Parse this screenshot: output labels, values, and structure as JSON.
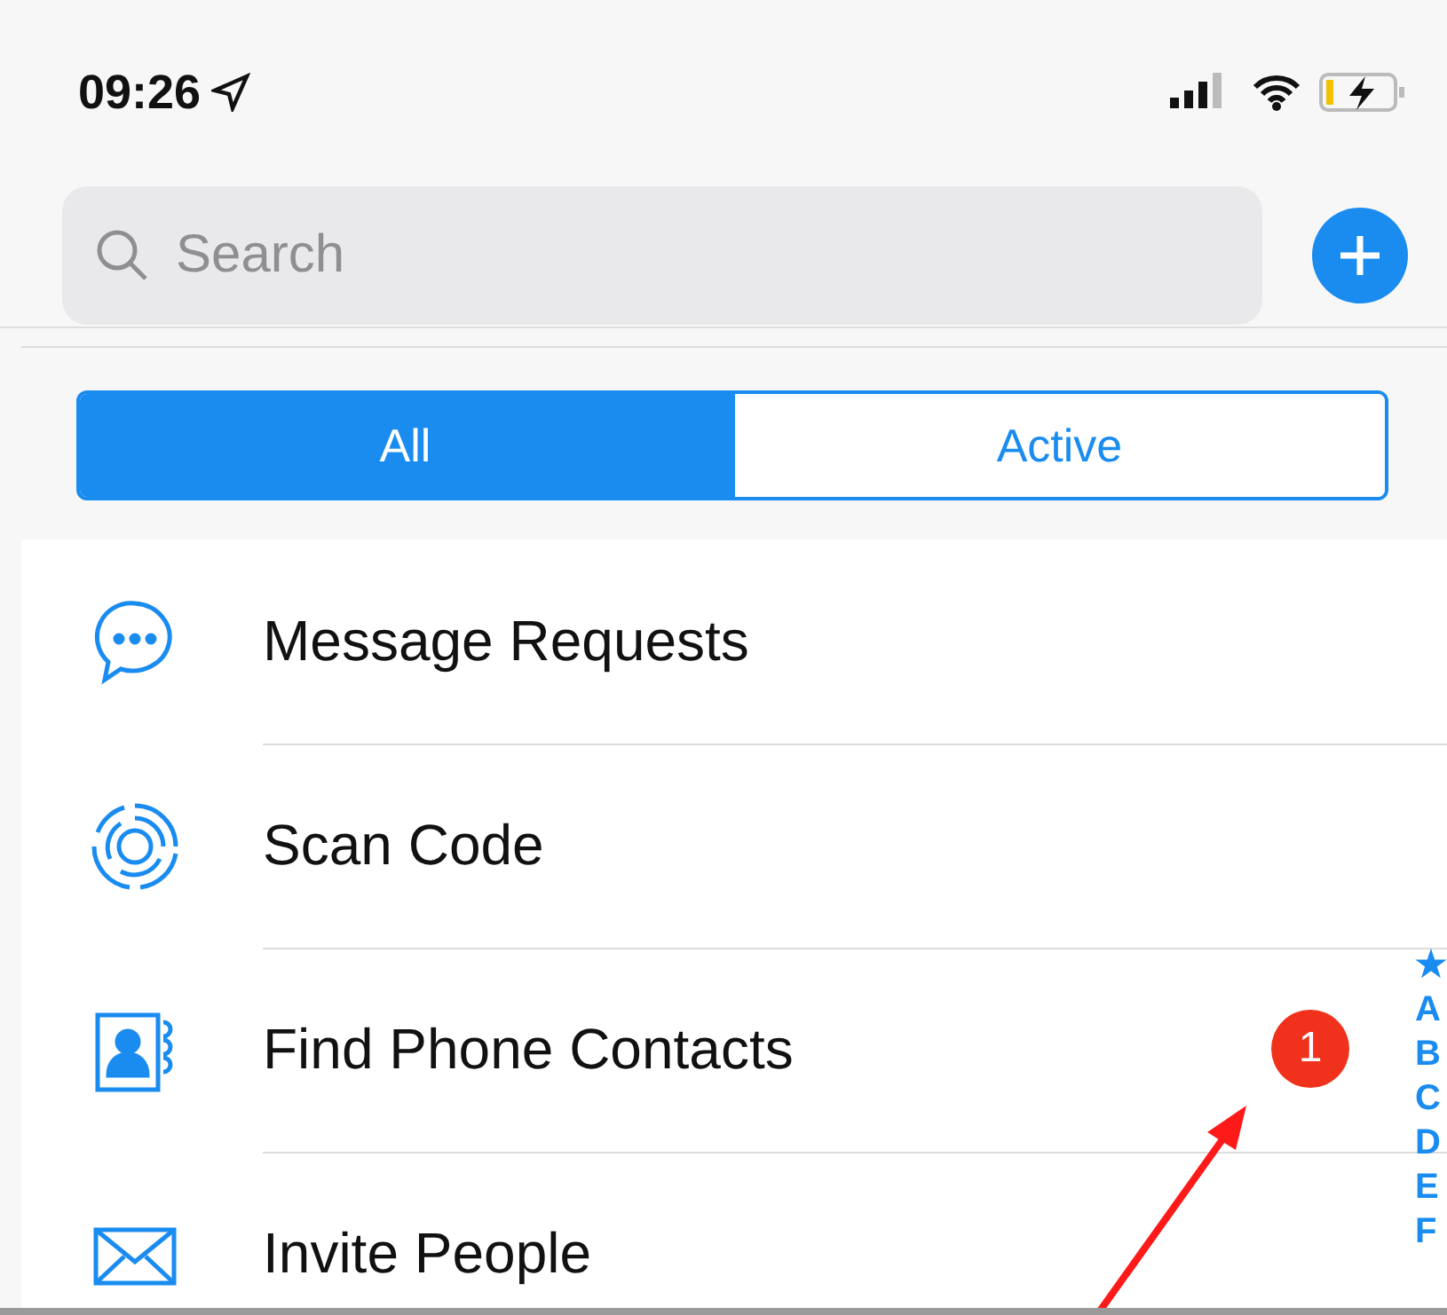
{
  "status_bar": {
    "time": "09:26"
  },
  "search": {
    "placeholder": "Search"
  },
  "segments": [
    {
      "label": "All",
      "selected": true
    },
    {
      "label": "Active",
      "selected": false
    }
  ],
  "rows": [
    {
      "kind": "requests",
      "label": "Message Requests"
    },
    {
      "kind": "scan",
      "label": "Scan Code"
    },
    {
      "kind": "contacts",
      "label": "Find Phone Contacts",
      "badge": "1"
    },
    {
      "kind": "invite",
      "label": "Invite People"
    }
  ],
  "index": [
    "★",
    "A",
    "B",
    "C",
    "D",
    "E",
    "F"
  ]
}
